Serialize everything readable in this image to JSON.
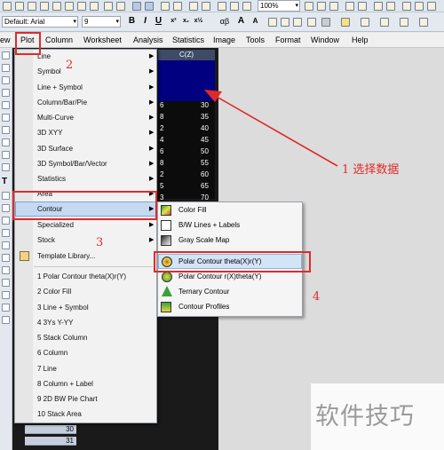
{
  "toolbar_top": {
    "zoom": "100%"
  },
  "format_toolbar": {
    "font_label": "Default: Arial",
    "font_size": "9",
    "bold": "B",
    "italic": "I",
    "underline": "U",
    "greek": "αβ",
    "font_a_up": "A",
    "font_a_down": "A"
  },
  "menubar": [
    "ew",
    "Plot",
    "Column",
    "Worksheet",
    "Analysis",
    "Statistics",
    "Image",
    "Tools",
    "Format",
    "Window",
    "Help"
  ],
  "sheet": {
    "column_header": "C(Z)",
    "row_numbers": [
      "30",
      "31"
    ],
    "col_b_values": [
      "6",
      "8",
      "2",
      "4",
      "6",
      "8",
      "2",
      "5",
      "3"
    ],
    "col_c_values": [
      "30",
      "35",
      "40",
      "45",
      "50",
      "55",
      "60",
      "65",
      "70"
    ]
  },
  "plot_menu": {
    "items": [
      "Line",
      "Symbol",
      "Line + Symbol",
      "Column/Bar/Pie",
      "Multi-Curve",
      "3D XYY",
      "3D Surface",
      "3D Symbol/Bar/Vector",
      "Statistics",
      "Area",
      "Contour",
      "Specialized",
      "Stock",
      "Template Library..."
    ],
    "recent": [
      "1 Polar Contour theta(X)r(Y)",
      "2 Color Fill",
      "3 Line + Symbol",
      "4 3Ys Y-YY",
      "5 Stack Column",
      "6 Column",
      "7 Line",
      "8 Column + Label",
      "9 2D BW Pie Chart",
      "10 Stack Area"
    ]
  },
  "contour_submenu": {
    "items": [
      "Color Fill",
      "B/W Lines + Labels",
      "Gray Scale Map",
      "Polar Contour theta(X)r(Y)",
      "Polar Contour r(X)theta(Y)",
      "Ternary Contour",
      "Contour Profiles"
    ]
  },
  "annotations": {
    "step1": "1  选择数据",
    "step2": "2",
    "step3": "3",
    "step4": "4",
    "color": "#e02a2a"
  },
  "watermark": "软件技巧"
}
